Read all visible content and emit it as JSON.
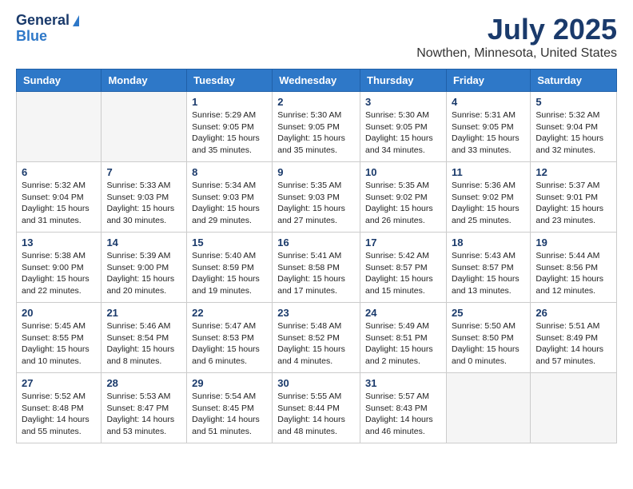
{
  "header": {
    "logo_line1": "General",
    "logo_line2": "Blue",
    "main_title": "July 2025",
    "subtitle": "Nowthen, Minnesota, United States"
  },
  "days_of_week": [
    "Sunday",
    "Monday",
    "Tuesday",
    "Wednesday",
    "Thursday",
    "Friday",
    "Saturday"
  ],
  "weeks": [
    [
      {
        "day": "",
        "info": ""
      },
      {
        "day": "",
        "info": ""
      },
      {
        "day": "1",
        "info": "Sunrise: 5:29 AM\nSunset: 9:05 PM\nDaylight: 15 hours and 35 minutes."
      },
      {
        "day": "2",
        "info": "Sunrise: 5:30 AM\nSunset: 9:05 PM\nDaylight: 15 hours and 35 minutes."
      },
      {
        "day": "3",
        "info": "Sunrise: 5:30 AM\nSunset: 9:05 PM\nDaylight: 15 hours and 34 minutes."
      },
      {
        "day": "4",
        "info": "Sunrise: 5:31 AM\nSunset: 9:05 PM\nDaylight: 15 hours and 33 minutes."
      },
      {
        "day": "5",
        "info": "Sunrise: 5:32 AM\nSunset: 9:04 PM\nDaylight: 15 hours and 32 minutes."
      }
    ],
    [
      {
        "day": "6",
        "info": "Sunrise: 5:32 AM\nSunset: 9:04 PM\nDaylight: 15 hours and 31 minutes."
      },
      {
        "day": "7",
        "info": "Sunrise: 5:33 AM\nSunset: 9:03 PM\nDaylight: 15 hours and 30 minutes."
      },
      {
        "day": "8",
        "info": "Sunrise: 5:34 AM\nSunset: 9:03 PM\nDaylight: 15 hours and 29 minutes."
      },
      {
        "day": "9",
        "info": "Sunrise: 5:35 AM\nSunset: 9:03 PM\nDaylight: 15 hours and 27 minutes."
      },
      {
        "day": "10",
        "info": "Sunrise: 5:35 AM\nSunset: 9:02 PM\nDaylight: 15 hours and 26 minutes."
      },
      {
        "day": "11",
        "info": "Sunrise: 5:36 AM\nSunset: 9:02 PM\nDaylight: 15 hours and 25 minutes."
      },
      {
        "day": "12",
        "info": "Sunrise: 5:37 AM\nSunset: 9:01 PM\nDaylight: 15 hours and 23 minutes."
      }
    ],
    [
      {
        "day": "13",
        "info": "Sunrise: 5:38 AM\nSunset: 9:00 PM\nDaylight: 15 hours and 22 minutes."
      },
      {
        "day": "14",
        "info": "Sunrise: 5:39 AM\nSunset: 9:00 PM\nDaylight: 15 hours and 20 minutes."
      },
      {
        "day": "15",
        "info": "Sunrise: 5:40 AM\nSunset: 8:59 PM\nDaylight: 15 hours and 19 minutes."
      },
      {
        "day": "16",
        "info": "Sunrise: 5:41 AM\nSunset: 8:58 PM\nDaylight: 15 hours and 17 minutes."
      },
      {
        "day": "17",
        "info": "Sunrise: 5:42 AM\nSunset: 8:57 PM\nDaylight: 15 hours and 15 minutes."
      },
      {
        "day": "18",
        "info": "Sunrise: 5:43 AM\nSunset: 8:57 PM\nDaylight: 15 hours and 13 minutes."
      },
      {
        "day": "19",
        "info": "Sunrise: 5:44 AM\nSunset: 8:56 PM\nDaylight: 15 hours and 12 minutes."
      }
    ],
    [
      {
        "day": "20",
        "info": "Sunrise: 5:45 AM\nSunset: 8:55 PM\nDaylight: 15 hours and 10 minutes."
      },
      {
        "day": "21",
        "info": "Sunrise: 5:46 AM\nSunset: 8:54 PM\nDaylight: 15 hours and 8 minutes."
      },
      {
        "day": "22",
        "info": "Sunrise: 5:47 AM\nSunset: 8:53 PM\nDaylight: 15 hours and 6 minutes."
      },
      {
        "day": "23",
        "info": "Sunrise: 5:48 AM\nSunset: 8:52 PM\nDaylight: 15 hours and 4 minutes."
      },
      {
        "day": "24",
        "info": "Sunrise: 5:49 AM\nSunset: 8:51 PM\nDaylight: 15 hours and 2 minutes."
      },
      {
        "day": "25",
        "info": "Sunrise: 5:50 AM\nSunset: 8:50 PM\nDaylight: 15 hours and 0 minutes."
      },
      {
        "day": "26",
        "info": "Sunrise: 5:51 AM\nSunset: 8:49 PM\nDaylight: 14 hours and 57 minutes."
      }
    ],
    [
      {
        "day": "27",
        "info": "Sunrise: 5:52 AM\nSunset: 8:48 PM\nDaylight: 14 hours and 55 minutes."
      },
      {
        "day": "28",
        "info": "Sunrise: 5:53 AM\nSunset: 8:47 PM\nDaylight: 14 hours and 53 minutes."
      },
      {
        "day": "29",
        "info": "Sunrise: 5:54 AM\nSunset: 8:45 PM\nDaylight: 14 hours and 51 minutes."
      },
      {
        "day": "30",
        "info": "Sunrise: 5:55 AM\nSunset: 8:44 PM\nDaylight: 14 hours and 48 minutes."
      },
      {
        "day": "31",
        "info": "Sunrise: 5:57 AM\nSunset: 8:43 PM\nDaylight: 14 hours and 46 minutes."
      },
      {
        "day": "",
        "info": ""
      },
      {
        "day": "",
        "info": ""
      }
    ]
  ]
}
